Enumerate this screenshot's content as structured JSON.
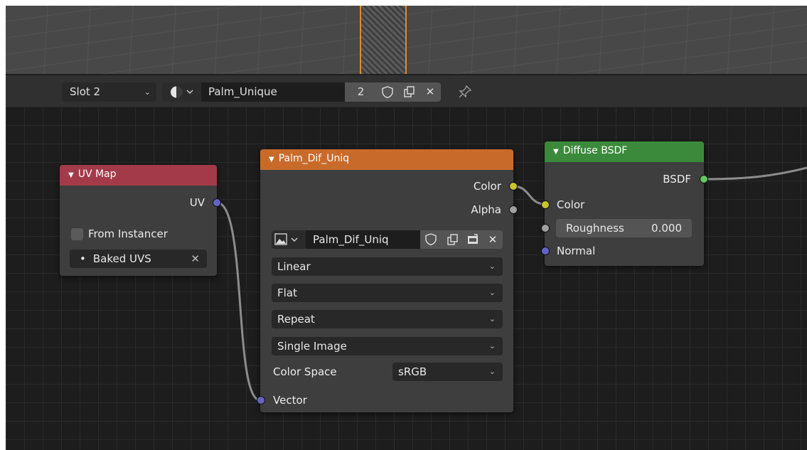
{
  "header": {
    "slot_label": "Slot 2",
    "material_name": "Palm_Unique",
    "material_users": "2",
    "icons": [
      "material-sphere-icon",
      "chevron-down-icon",
      "fake-user-shield-icon",
      "duplicate-icon",
      "close-icon",
      "pin-icon"
    ]
  },
  "nodes": {
    "uv_map": {
      "title": "UV Map",
      "output_uv": "UV",
      "from_instancer": "From Instancer",
      "uv_name": "Baked UVS",
      "header_color": "#a33a4a"
    },
    "image_texture": {
      "title": "Palm_Dif_Uniq",
      "out_color": "Color",
      "out_alpha": "Alpha",
      "image_name": "Palm_Dif_Uniq",
      "interpolation": "Linear",
      "projection": "Flat",
      "extension": "Repeat",
      "source": "Single Image",
      "color_space_label": "Color Space",
      "color_space_value": "sRGB",
      "input_vector": "Vector",
      "header_color": "#c86b2a"
    },
    "diffuse_bsdf": {
      "title": "Diffuse BSDF",
      "out_bsdf": "BSDF",
      "in_color": "Color",
      "roughness_label": "Roughness",
      "roughness_value": "0.000",
      "in_normal": "Normal",
      "header_color": "#3b8a3b"
    }
  },
  "socket_colors": {
    "vector": "#6363c7",
    "color": "#c7c729",
    "float": "#a1a1a1",
    "shader": "#63c763"
  }
}
